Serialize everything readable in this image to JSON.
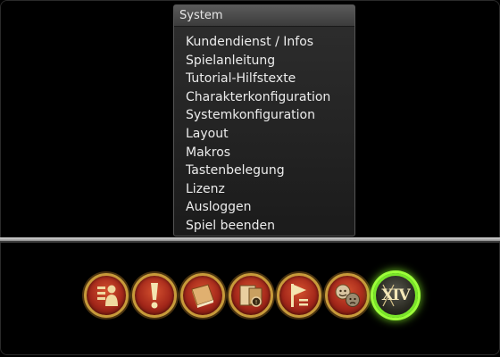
{
  "menu": {
    "title": "System",
    "items": [
      {
        "label": "Kundendienst / Infos"
      },
      {
        "label": "Spielanleitung"
      },
      {
        "label": "Tutorial-Hilfstexte"
      },
      {
        "label": "Charakterkonfiguration"
      },
      {
        "label": "Systemkonfiguration"
      },
      {
        "label": "Layout"
      },
      {
        "label": "Makros"
      },
      {
        "label": "Tastenbelegung"
      },
      {
        "label": "Lizenz"
      },
      {
        "label": "Ausloggen"
      },
      {
        "label": "Spiel beenden"
      }
    ]
  },
  "hotbar": {
    "buttons": [
      {
        "icon": "character-list-icon"
      },
      {
        "icon": "alert-icon"
      },
      {
        "icon": "book-icon"
      },
      {
        "icon": "inventory-icon"
      },
      {
        "icon": "flag-icon"
      },
      {
        "icon": "social-icon"
      },
      {
        "icon": "system-menu-icon",
        "text": "XIV",
        "active": true
      }
    ]
  },
  "colors": {
    "button_red": "#a3271a",
    "button_gold_rim": "#c79a3a",
    "active_glow": "#9cff3a"
  }
}
